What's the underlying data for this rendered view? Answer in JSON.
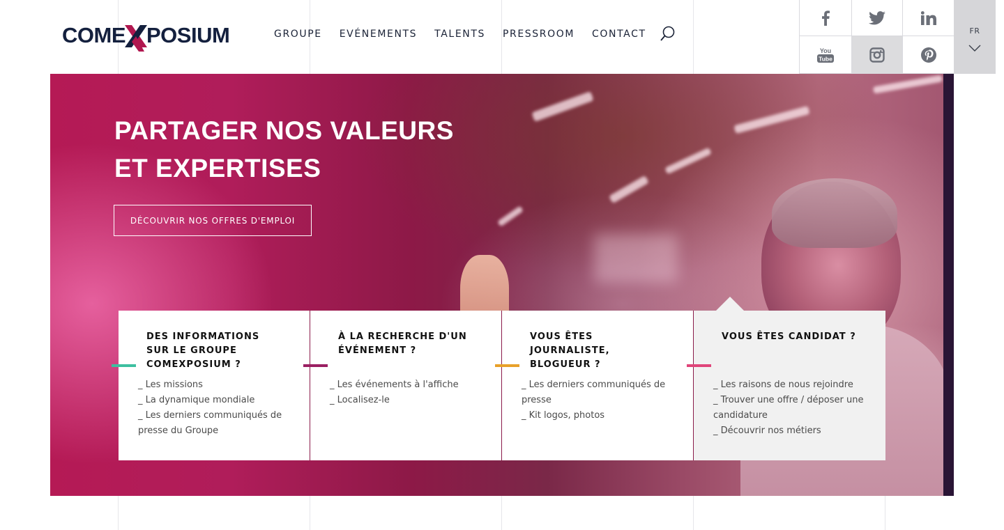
{
  "brand": {
    "logo_left": "COME",
    "logo_right": "POSIUM",
    "logo_x_color": "#b0174f",
    "logo_text_color": "#14203e"
  },
  "nav": {
    "items": [
      {
        "label": "GROUPE"
      },
      {
        "label": "EVÉNEMENTS"
      },
      {
        "label": "TALENTS"
      },
      {
        "label": "PRESSROOM"
      },
      {
        "label": "CONTACT"
      }
    ],
    "search_icon": "search-icon"
  },
  "social": {
    "items": [
      {
        "icon": "facebook-icon"
      },
      {
        "icon": "twitter-icon"
      },
      {
        "icon": "linkedin-icon"
      },
      {
        "icon": "youtube-icon",
        "label_top": "You",
        "label_bottom": "Tube"
      },
      {
        "icon": "instagram-icon"
      },
      {
        "icon": "pinterest-icon"
      }
    ],
    "icon_color": "#6b6f78"
  },
  "language": {
    "current": "FR",
    "icon": "chevron-down-icon"
  },
  "hero": {
    "title_line1": "PARTAGER NOS VALEURS",
    "title_line2": "ET EXPERTISES",
    "cta_label": "DÉCOUVRIR NOS OFFRES D'EMPLOI"
  },
  "cards": [
    {
      "title": "DES INFORMATIONS SUR LE GROUPE COMEXPOSIUM ?",
      "accent": "#3dbfa0",
      "links": [
        "_ Les missions",
        "_ La dynamique mondiale",
        "_ Les derniers communiqués de presse du Groupe"
      ]
    },
    {
      "title": "À LA RECHERCHE D'UN ÉVÉNEMENT ?",
      "accent": "#9b1f62",
      "links": [
        "_ Les événements à l'affiche",
        "_ Localisez-le"
      ]
    },
    {
      "title": "VOUS ÊTES JOURNALISTE, BLOGUEUR ?",
      "accent": "#e8a12a",
      "links": [
        "_ Les derniers communiqués de presse",
        "_ Kit logos, photos"
      ]
    },
    {
      "title": "VOUS ÊTES CANDIDAT ?",
      "accent": "#e0457a",
      "links": [
        "_ Les raisons de nous rejoindre",
        "_ Trouver une offre / déposer une candidature",
        "_ Découvrir nos métiers"
      ]
    }
  ]
}
